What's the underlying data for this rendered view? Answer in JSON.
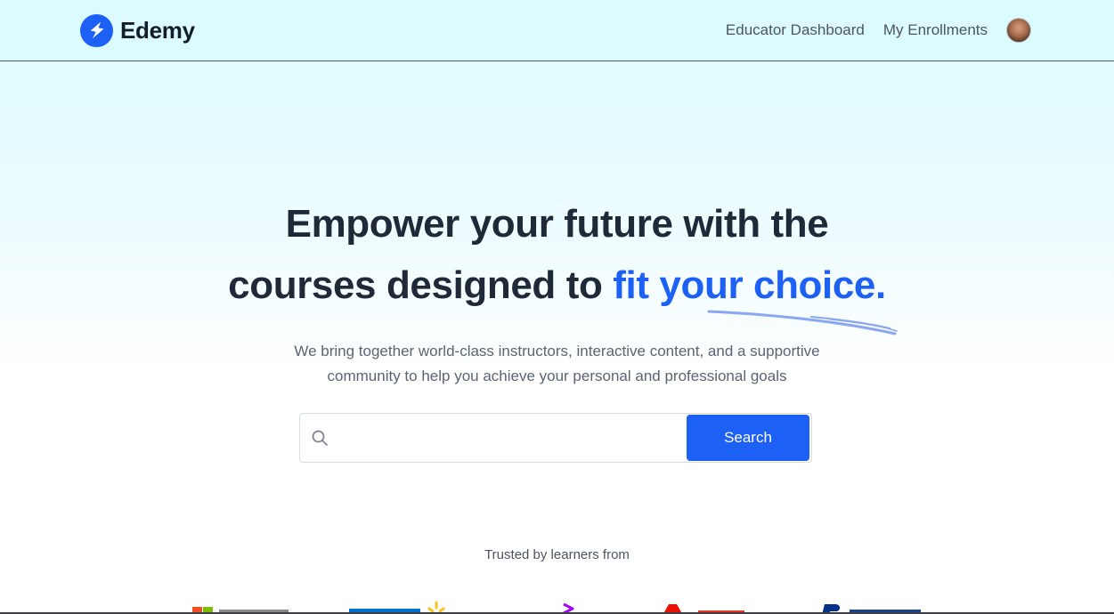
{
  "nav": {
    "brand": "Edemy",
    "links": [
      "Educator Dashboard",
      "My Enrollments"
    ]
  },
  "hero": {
    "headline_line1": "Empower your future with the",
    "headline_line2_plain": "courses designed to ",
    "headline_line2_accent": "fit your choice.",
    "subtitle_line1": "We bring together world-class instructors, interactive content, and a supportive",
    "subtitle_line2": "community to help you achieve your personal and professional goals"
  },
  "search": {
    "placeholder": "",
    "value": "",
    "button_label": "Search"
  },
  "trusted": {
    "label": "Trusted by learners from",
    "companies": [
      "microsoft-logo",
      "walmart-logo",
      "accenture-logo",
      "adobe-logo",
      "paypal-logo"
    ]
  },
  "colors": {
    "accent": "#1d60f5",
    "text_dark": "#1f2937",
    "text_muted": "#5b6472"
  }
}
